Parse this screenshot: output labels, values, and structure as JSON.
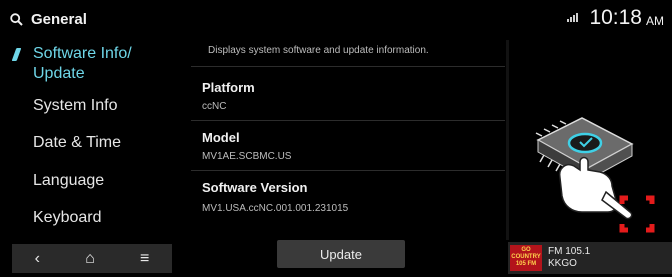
{
  "header": {
    "title": "General",
    "search_icon": "search-icon",
    "signal_icon": "signal-icon",
    "time": "10:18",
    "ampm": "AM"
  },
  "sidebar": {
    "items": [
      {
        "label": "Software Info/ Update",
        "line1": "Software Info/",
        "line2": "Update",
        "active": true
      },
      {
        "label": "System Info"
      },
      {
        "label": "Date & Time"
      },
      {
        "label": "Language"
      },
      {
        "label": "Keyboard"
      }
    ]
  },
  "content": {
    "description": "Displays system software and update information.",
    "fields": [
      {
        "label": "Platform",
        "value": "ccNC"
      },
      {
        "label": "Model",
        "value": "MV1AE.SCBMC.US"
      },
      {
        "label": "Software Version",
        "value": "MV1.USA.ccNC.001.001.231015"
      }
    ]
  },
  "bottom_nav": {
    "back": "‹",
    "home": "⌂",
    "menu": "≡",
    "update_label": "Update"
  },
  "radio": {
    "station": "FM 105.1",
    "call_sign": "KKGO",
    "logo_text_1": "GO",
    "logo_text_2": "COUNTRY",
    "logo_text_3": "105 FM"
  },
  "colors": {
    "accent": "#6fd6e8",
    "background": "#000000",
    "highlight_red": "#e41b1b"
  }
}
